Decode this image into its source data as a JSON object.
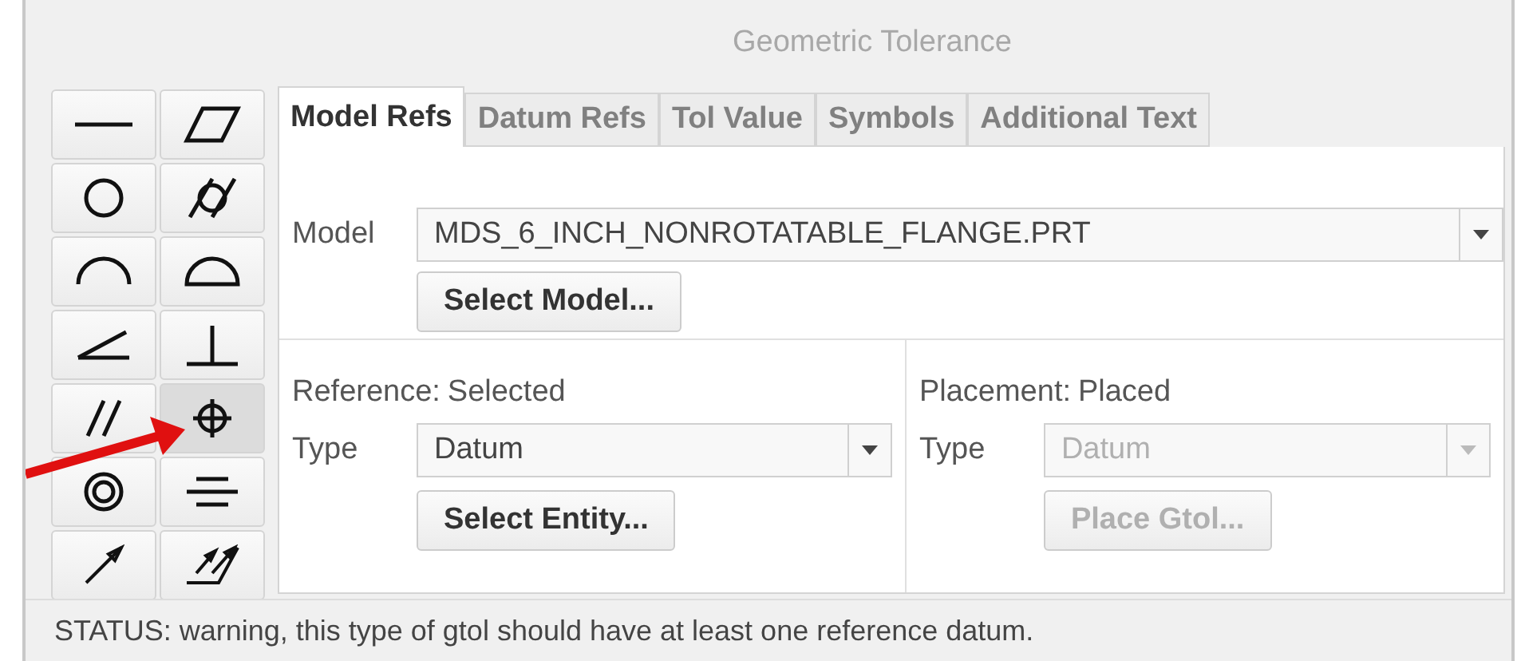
{
  "window": {
    "title": "Geometric Tolerance"
  },
  "symbols": [
    {
      "kind": "straightness",
      "selected": false
    },
    {
      "kind": "flatness",
      "selected": false
    },
    {
      "kind": "circularity",
      "selected": false
    },
    {
      "kind": "cylindricity",
      "selected": false
    },
    {
      "kind": "line-profile",
      "selected": false
    },
    {
      "kind": "surface-profile",
      "selected": false
    },
    {
      "kind": "angularity",
      "selected": false
    },
    {
      "kind": "perpendicularity",
      "selected": false
    },
    {
      "kind": "parallelism",
      "selected": false
    },
    {
      "kind": "position",
      "selected": true
    },
    {
      "kind": "concentricity",
      "selected": false
    },
    {
      "kind": "symmetry",
      "selected": false
    },
    {
      "kind": "circular-runout",
      "selected": false
    },
    {
      "kind": "total-runout",
      "selected": false
    }
  ],
  "tabs": [
    {
      "label": "Model Refs",
      "selected": true
    },
    {
      "label": "Datum Refs",
      "selected": false
    },
    {
      "label": "Tol Value",
      "selected": false
    },
    {
      "label": "Symbols",
      "selected": false
    },
    {
      "label": "Additional Text",
      "selected": false
    }
  ],
  "model": {
    "label": "Model",
    "value": "MDS_6_INCH_NONROTATABLE_FLANGE.PRT",
    "button": "Select Model..."
  },
  "reference": {
    "heading": "Reference:",
    "status": "Selected",
    "type_label": "Type",
    "type_value": "Datum",
    "disabled": false,
    "button": "Select Entity..."
  },
  "placement": {
    "heading": "Placement:",
    "status": "Placed",
    "type_label": "Type",
    "type_value": "Datum",
    "disabled": true,
    "button": "Place Gtol..."
  },
  "status_bar": "STATUS: warning, this type of gtol should have at least one reference datum."
}
